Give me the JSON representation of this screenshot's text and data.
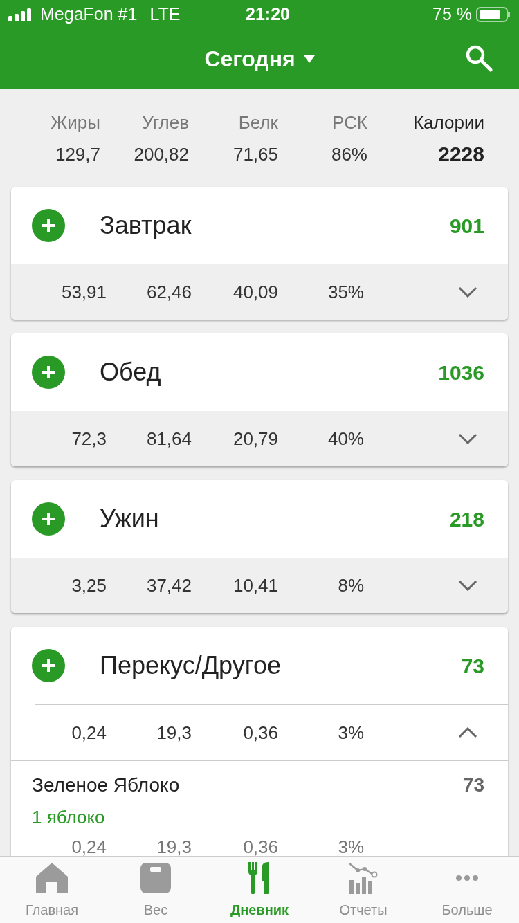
{
  "status_bar": {
    "carrier": "MegaFon #1",
    "network": "LTE",
    "time": "21:20",
    "battery": "75 %"
  },
  "header": {
    "title": "Сегодня"
  },
  "totals": [
    {
      "label": "Жиры",
      "value": "129,7",
      "bold": false
    },
    {
      "label": "Углев",
      "value": "200,82",
      "bold": false
    },
    {
      "label": "Белк",
      "value": "71,65",
      "bold": false
    },
    {
      "label": "РСК",
      "value": "86%",
      "bold": false
    },
    {
      "label": "Калории",
      "value": "2228",
      "bold": true
    }
  ],
  "meals": [
    {
      "name": "Завтрак",
      "calories": "901",
      "values": [
        "53,91",
        "62,46",
        "40,09",
        "35%"
      ],
      "expanded": false
    },
    {
      "name": "Обед",
      "calories": "1036",
      "values": [
        "72,3",
        "81,64",
        "20,79",
        "40%"
      ],
      "expanded": false
    },
    {
      "name": "Ужин",
      "calories": "218",
      "values": [
        "3,25",
        "37,42",
        "10,41",
        "8%"
      ],
      "expanded": false
    },
    {
      "name": "Перекус/Другое",
      "calories": "73",
      "values": [
        "0,24",
        "19,3",
        "0,36",
        "3%"
      ],
      "expanded": true,
      "items": [
        {
          "name": "Зеленое Яблоко",
          "portion": "1 яблоко",
          "calories": "73",
          "values": [
            "0,24",
            "19,3",
            "0,36",
            "3%"
          ]
        }
      ]
    }
  ],
  "tabs": [
    {
      "label": "Главная",
      "selected": false
    },
    {
      "label": "Вес",
      "selected": false
    },
    {
      "label": "Дневник",
      "selected": true
    },
    {
      "label": "Отчеты",
      "selected": false
    },
    {
      "label": "Больше",
      "selected": false
    }
  ]
}
